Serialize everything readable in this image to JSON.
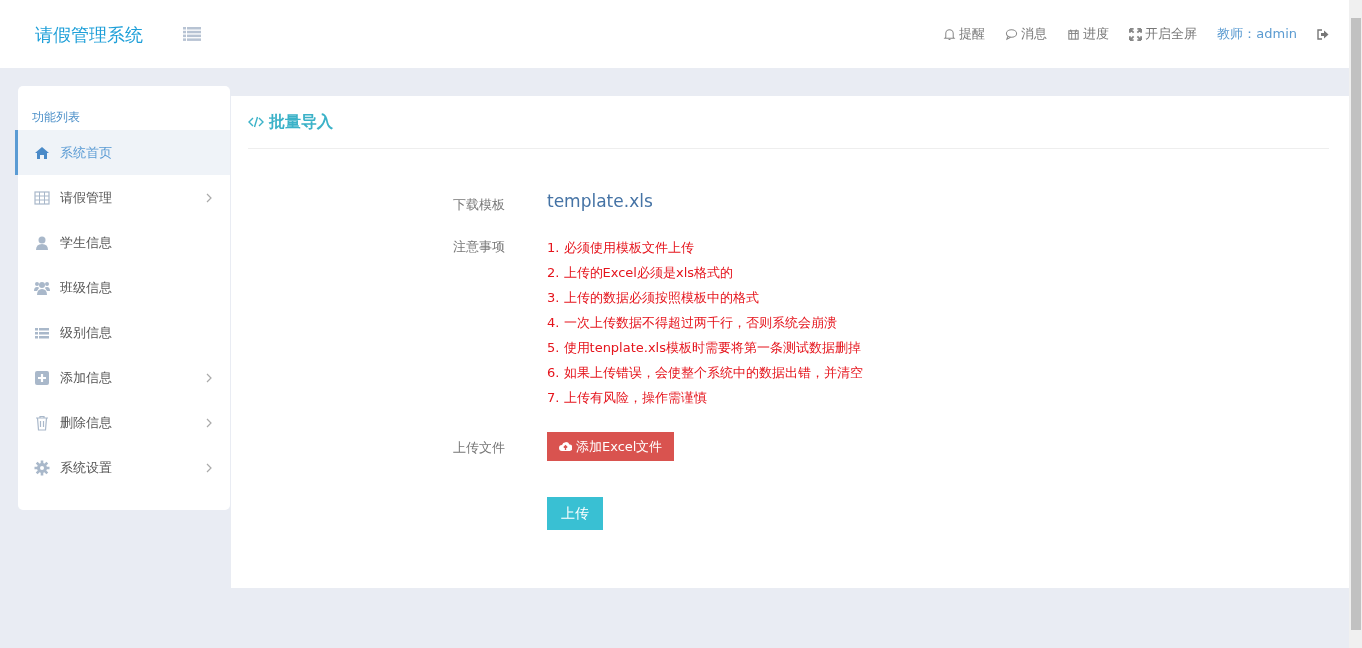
{
  "app": {
    "title": "请假管理系统"
  },
  "topbar": {
    "items": [
      {
        "label": "提醒"
      },
      {
        "label": "消息"
      },
      {
        "label": "进度"
      },
      {
        "label": "开启全屏"
      }
    ],
    "user": "教师：admin"
  },
  "sidebar": {
    "heading": "功能列表",
    "items": [
      {
        "label": "系统首页",
        "selected": true,
        "expandable": false
      },
      {
        "label": "请假管理",
        "selected": false,
        "expandable": true
      },
      {
        "label": "学生信息",
        "selected": false,
        "expandable": false
      },
      {
        "label": "班级信息",
        "selected": false,
        "expandable": false
      },
      {
        "label": "级别信息",
        "selected": false,
        "expandable": false
      },
      {
        "label": "添加信息",
        "selected": false,
        "expandable": true
      },
      {
        "label": "删除信息",
        "selected": false,
        "expandable": true
      },
      {
        "label": "系统设置",
        "selected": false,
        "expandable": true
      }
    ]
  },
  "panel": {
    "title": "批量导入",
    "template_label": "下载模板",
    "template_link": "template.xls",
    "notes_label": "注意事项",
    "notes": [
      "1. 必须使用模板文件上传",
      "2. 上传的Excel必须是xls格式的",
      "3. 上传的数据必须按照模板中的格式",
      "4. 一次上传数据不得超过两千行，否则系统会崩溃",
      "5. 使用tenplate.xls模板时需要将第一条测试数据删掉",
      "6. 如果上传错误，会使整个系统中的数据出错，并清空",
      "7. 上传有风险，操作需谨慎"
    ],
    "file_label": "上传文件",
    "add_button": "添加Excel文件",
    "submit_button": "上传"
  }
}
